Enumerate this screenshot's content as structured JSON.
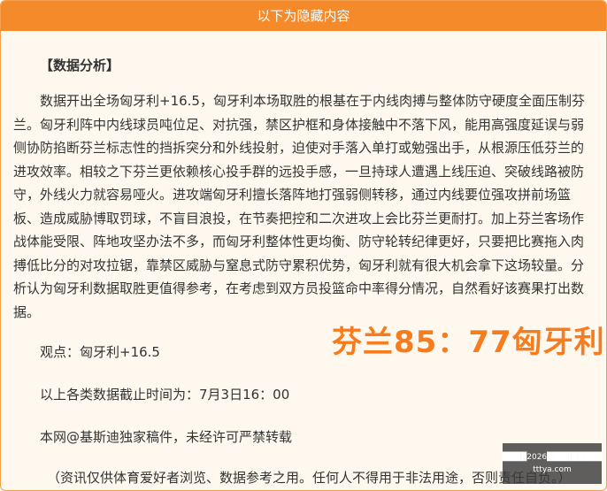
{
  "header": {
    "title": "以下为隐藏内容"
  },
  "content": {
    "section_title": "【数据分析】",
    "analysis": "数据开出全场匈牙利+16.5，匈牙利本场取胜的根基在于内线肉搏与整体防守硬度全面压制芬兰。匈牙利阵中内线球员吨位足、对抗强，禁区护框和身体接触中不落下风，能用高强度延误与弱侧协防掐断芬兰标志性的挡拆突分和外线投射，迫使对手落入单打或勉强出手，从根源压低芬兰的进攻效率。相较之下芬兰更依赖核心投手群的远投手感，一旦持球人遭遇上线压迫、突破线路被防守，外线火力就容易哑火。进攻端匈牙利擅长落阵地打强弱侧转移，通过内线要位强攻拼前场篮板、造成威胁博取罚球，不盲目浪投，在节奏把控和二次进攻上会比芬兰更耐打。加上芬兰客场作战体能受限、阵地攻坚办法不多，而匈牙利整体性更均衡、防守轮转纪律更好，只要把比赛拖入肉搏低比分的对攻拉锯，靠禁区威胁与窒息式防守累积优势，匈牙利就有很大机会拿下这场较量。分析认为匈牙利数据取胜更值得参考，在考虑到双方员投篮命中率得分情况，自然看好该赛果打出数据。",
    "view": "观点：匈牙利+16.5",
    "deadline": "以上各类数据截止时间为：7月3日16：00",
    "copyright": "本网@基斯迪独家稿件，未经许可严禁转载",
    "disclaimer": "（资讯仅供体育爱好者浏览、数据参考之用。任何人不得用于非法用途，否则责任自负。）"
  },
  "overlay": {
    "score": "芬兰85：77匈牙利"
  },
  "watermark": {
    "line1": "████2026█████████",
    "line2": "tttya.com"
  }
}
